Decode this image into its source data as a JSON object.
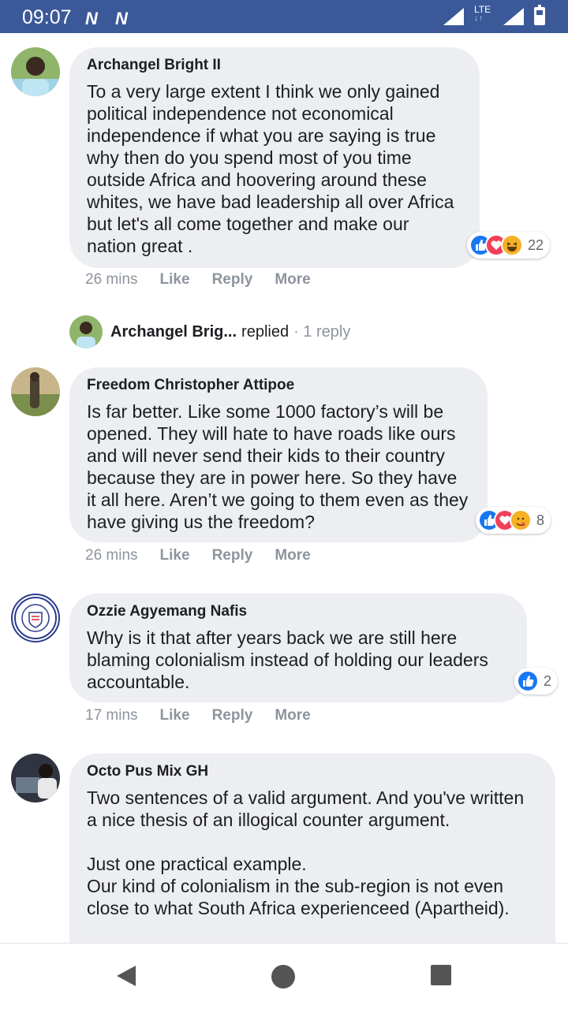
{
  "status_bar": {
    "time": "09:07",
    "notification_icons": [
      "N",
      "N"
    ],
    "network": "LTE"
  },
  "comments": [
    {
      "author": "Archangel Bright II",
      "text": "To a very large extent I think we only gained political independence not economical independence if what you are saying is true why then do you spend most of you time outside Africa and hoovering around these whites, we have bad leadership all over Africa but let's all come together and make our nation great .",
      "reactions": [
        "like",
        "love",
        "haha"
      ],
      "reaction_count": "22",
      "time": "26 mins",
      "actions": [
        "Like",
        "Reply",
        "More"
      ]
    },
    {
      "author": "Freedom Christopher Attipoe",
      "text": "Is far better. Like some 1000 factory’s will be opened. They will hate to have roads like ours and will never send their kids to their country because they are in power here. So they have it all here. Aren’t we going to them even as they have giving us the freedom?",
      "reactions": [
        "like",
        "love",
        "wow"
      ],
      "reaction_count": "8",
      "time": "26 mins",
      "actions": [
        "Like",
        "Reply",
        "More"
      ]
    },
    {
      "author": "Ozzie Agyemang Nafis",
      "text": "Why is it that after years back we are still here blaming colonialism instead of holding our leaders accountable.",
      "reactions": [
        "like"
      ],
      "reaction_count": "2",
      "time": "17 mins",
      "actions": [
        "Like",
        "Reply",
        "More"
      ]
    },
    {
      "author": "Octo Pus Mix GH",
      "text": "Two sentences of a valid argument. And you've written a nice thesis of an illogical counter argument.\n\nJust one practical example.\nOur kind of colonialism in the sub-region is not even close to what South Africa experienceed (Apartheid)."
    }
  ],
  "reply_summary": {
    "name": "Archangel Brig...",
    "verb": "replied",
    "count": "· 1 reply"
  },
  "nav": {
    "back": "back-icon",
    "home": "home-icon",
    "recents": "recents-icon"
  },
  "colors": {
    "status_bar": "#3b5998",
    "bubble": "#edeef2",
    "like": "#1877f2",
    "love": "#f33e58",
    "haha": "#f7b125",
    "meta_text": "#8d949e"
  }
}
